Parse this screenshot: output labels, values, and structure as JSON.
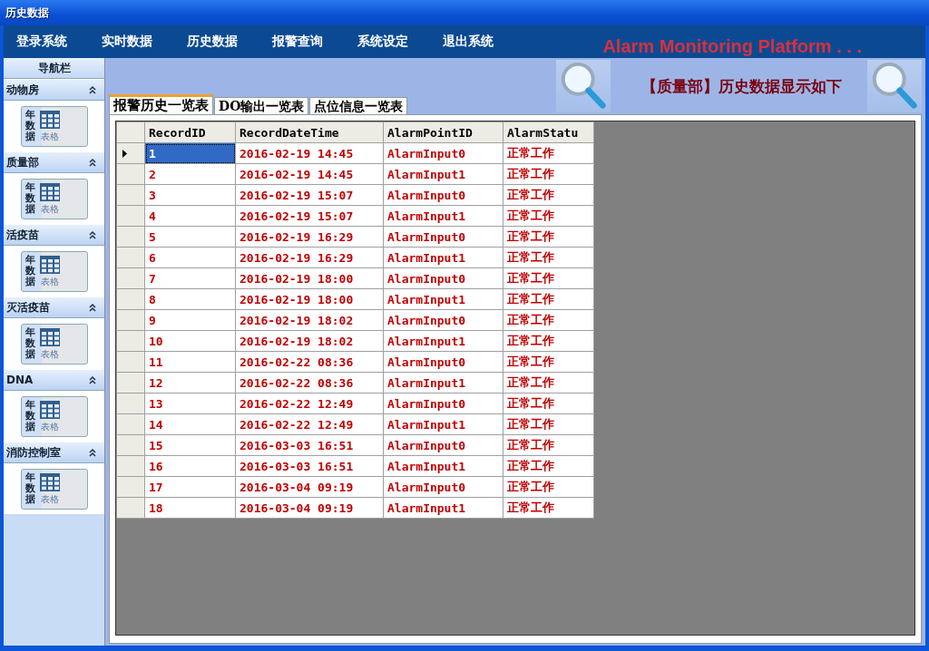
{
  "window": {
    "title": "历史数据"
  },
  "menu": [
    "登录系统",
    "实时数据",
    "历史数据",
    "报警查询",
    "系统设定",
    "退出系统"
  ],
  "platform_title": "Alarm Monitoring Platform . . .",
  "sidebar": {
    "title": "导航栏",
    "groups": [
      {
        "name": "动物房",
        "expanded": true,
        "item": {
          "vertical": "年数据",
          "label": "表格"
        }
      },
      {
        "name": "质量部",
        "expanded": true,
        "item": {
          "vertical": "年数据",
          "label": "表格"
        }
      },
      {
        "name": "活疫苗",
        "expanded": true,
        "item": {
          "vertical": "年数据",
          "label": "表格"
        }
      },
      {
        "name": "灭活疫苗",
        "expanded": true,
        "item": {
          "vertical": "年数据",
          "label": "表格"
        }
      },
      {
        "name": "DNA",
        "expanded": true,
        "item": {
          "vertical": "年数据",
          "label": "表格"
        }
      },
      {
        "name": "消防控制室",
        "expanded": true,
        "item": {
          "vertical": "年数据",
          "label": "表格"
        }
      }
    ]
  },
  "header_text": "【质量部】历史数据显示如下",
  "tabs": [
    {
      "label": "报警历史一览表",
      "selected": true
    },
    {
      "label": "DO输出一览表",
      "selected": false
    },
    {
      "label": "点位信息一览表",
      "selected": false
    }
  ],
  "table": {
    "columns": [
      "RecordID",
      "RecordDateTime",
      "AlarmPointID",
      "AlarmStatu"
    ],
    "rows": [
      {
        "selected": true,
        "cells": [
          "1",
          "2016-02-19 14:45",
          "AlarmInput0",
          "正常工作"
        ]
      },
      {
        "selected": false,
        "cells": [
          "2",
          "2016-02-19 14:45",
          "AlarmInput1",
          "正常工作"
        ]
      },
      {
        "selected": false,
        "cells": [
          "3",
          "2016-02-19 15:07",
          "AlarmInput0",
          "正常工作"
        ]
      },
      {
        "selected": false,
        "cells": [
          "4",
          "2016-02-19 15:07",
          "AlarmInput1",
          "正常工作"
        ]
      },
      {
        "selected": false,
        "cells": [
          "5",
          "2016-02-19 16:29",
          "AlarmInput0",
          "正常工作"
        ]
      },
      {
        "selected": false,
        "cells": [
          "6",
          "2016-02-19 16:29",
          "AlarmInput1",
          "正常工作"
        ]
      },
      {
        "selected": false,
        "cells": [
          "7",
          "2016-02-19 18:00",
          "AlarmInput0",
          "正常工作"
        ]
      },
      {
        "selected": false,
        "cells": [
          "8",
          "2016-02-19 18:00",
          "AlarmInput1",
          "正常工作"
        ]
      },
      {
        "selected": false,
        "cells": [
          "9",
          "2016-02-19 18:02",
          "AlarmInput0",
          "正常工作"
        ]
      },
      {
        "selected": false,
        "cells": [
          "10",
          "2016-02-19 18:02",
          "AlarmInput1",
          "正常工作"
        ]
      },
      {
        "selected": false,
        "cells": [
          "11",
          "2016-02-22 08:36",
          "AlarmInput0",
          "正常工作"
        ]
      },
      {
        "selected": false,
        "cells": [
          "12",
          "2016-02-22 08:36",
          "AlarmInput1",
          "正常工作"
        ]
      },
      {
        "selected": false,
        "cells": [
          "13",
          "2016-02-22 12:49",
          "AlarmInput0",
          "正常工作"
        ]
      },
      {
        "selected": false,
        "cells": [
          "14",
          "2016-02-22 12:49",
          "AlarmInput1",
          "正常工作"
        ]
      },
      {
        "selected": false,
        "cells": [
          "15",
          "2016-03-03 16:51",
          "AlarmInput0",
          "正常工作"
        ]
      },
      {
        "selected": false,
        "cells": [
          "16",
          "2016-03-03 16:51",
          "AlarmInput1",
          "正常工作"
        ]
      },
      {
        "selected": false,
        "cells": [
          "17",
          "2016-03-04 09:19",
          "AlarmInput0",
          "正常工作"
        ]
      },
      {
        "selected": false,
        "cells": [
          "18",
          "2016-03-04 09:19",
          "AlarmInput1",
          "正常工作"
        ]
      }
    ]
  }
}
